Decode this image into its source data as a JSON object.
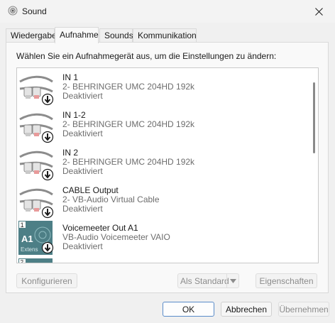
{
  "window": {
    "title": "Sound"
  },
  "tabs": [
    {
      "label": "Wiedergabe",
      "active": false
    },
    {
      "label": "Aufnahme",
      "active": true
    },
    {
      "label": "Sounds",
      "active": false
    },
    {
      "label": "Kommunikation",
      "active": false
    }
  ],
  "instruction": "Wählen Sie ein Aufnahmegerät aus, um die Einstellungen zu ändern:",
  "devices": [
    {
      "name": "IN 1",
      "driver": "2- BEHRINGER UMC 204HD 192k",
      "status": "Deaktiviert",
      "icon": "rca-cable-icon"
    },
    {
      "name": "IN 1-2",
      "driver": "2- BEHRINGER UMC 204HD 192k",
      "status": "Deaktiviert",
      "icon": "rca-cable-icon"
    },
    {
      "name": "IN 2",
      "driver": "2- BEHRINGER UMC 204HD 192k",
      "status": "Deaktiviert",
      "icon": "rca-cable-icon"
    },
    {
      "name": "CABLE Output",
      "driver": "2- VB-Audio Virtual Cable",
      "status": "Deaktiviert",
      "icon": "rca-cable-icon"
    },
    {
      "name": "Voicemeeter Out A1",
      "driver": "VB-Audio Voicemeeter VAIO",
      "status": "Deaktiviert",
      "icon": "voicemeeter-icon",
      "badge_num": "1",
      "badge_label": "A1",
      "badge_sub": "Extens"
    }
  ],
  "partial_badge_num": "2",
  "buttons": {
    "configure": "Konfigurieren",
    "set_default": "Als Standard",
    "properties": "Eigenschaften",
    "ok": "OK",
    "cancel": "Abbrechen",
    "apply": "Übernehmen"
  },
  "colors": {
    "disabled_arrow": "#1a1a1a",
    "voicemeeter_bg": "#4d7f86",
    "focus_border": "#5a8cc9"
  }
}
